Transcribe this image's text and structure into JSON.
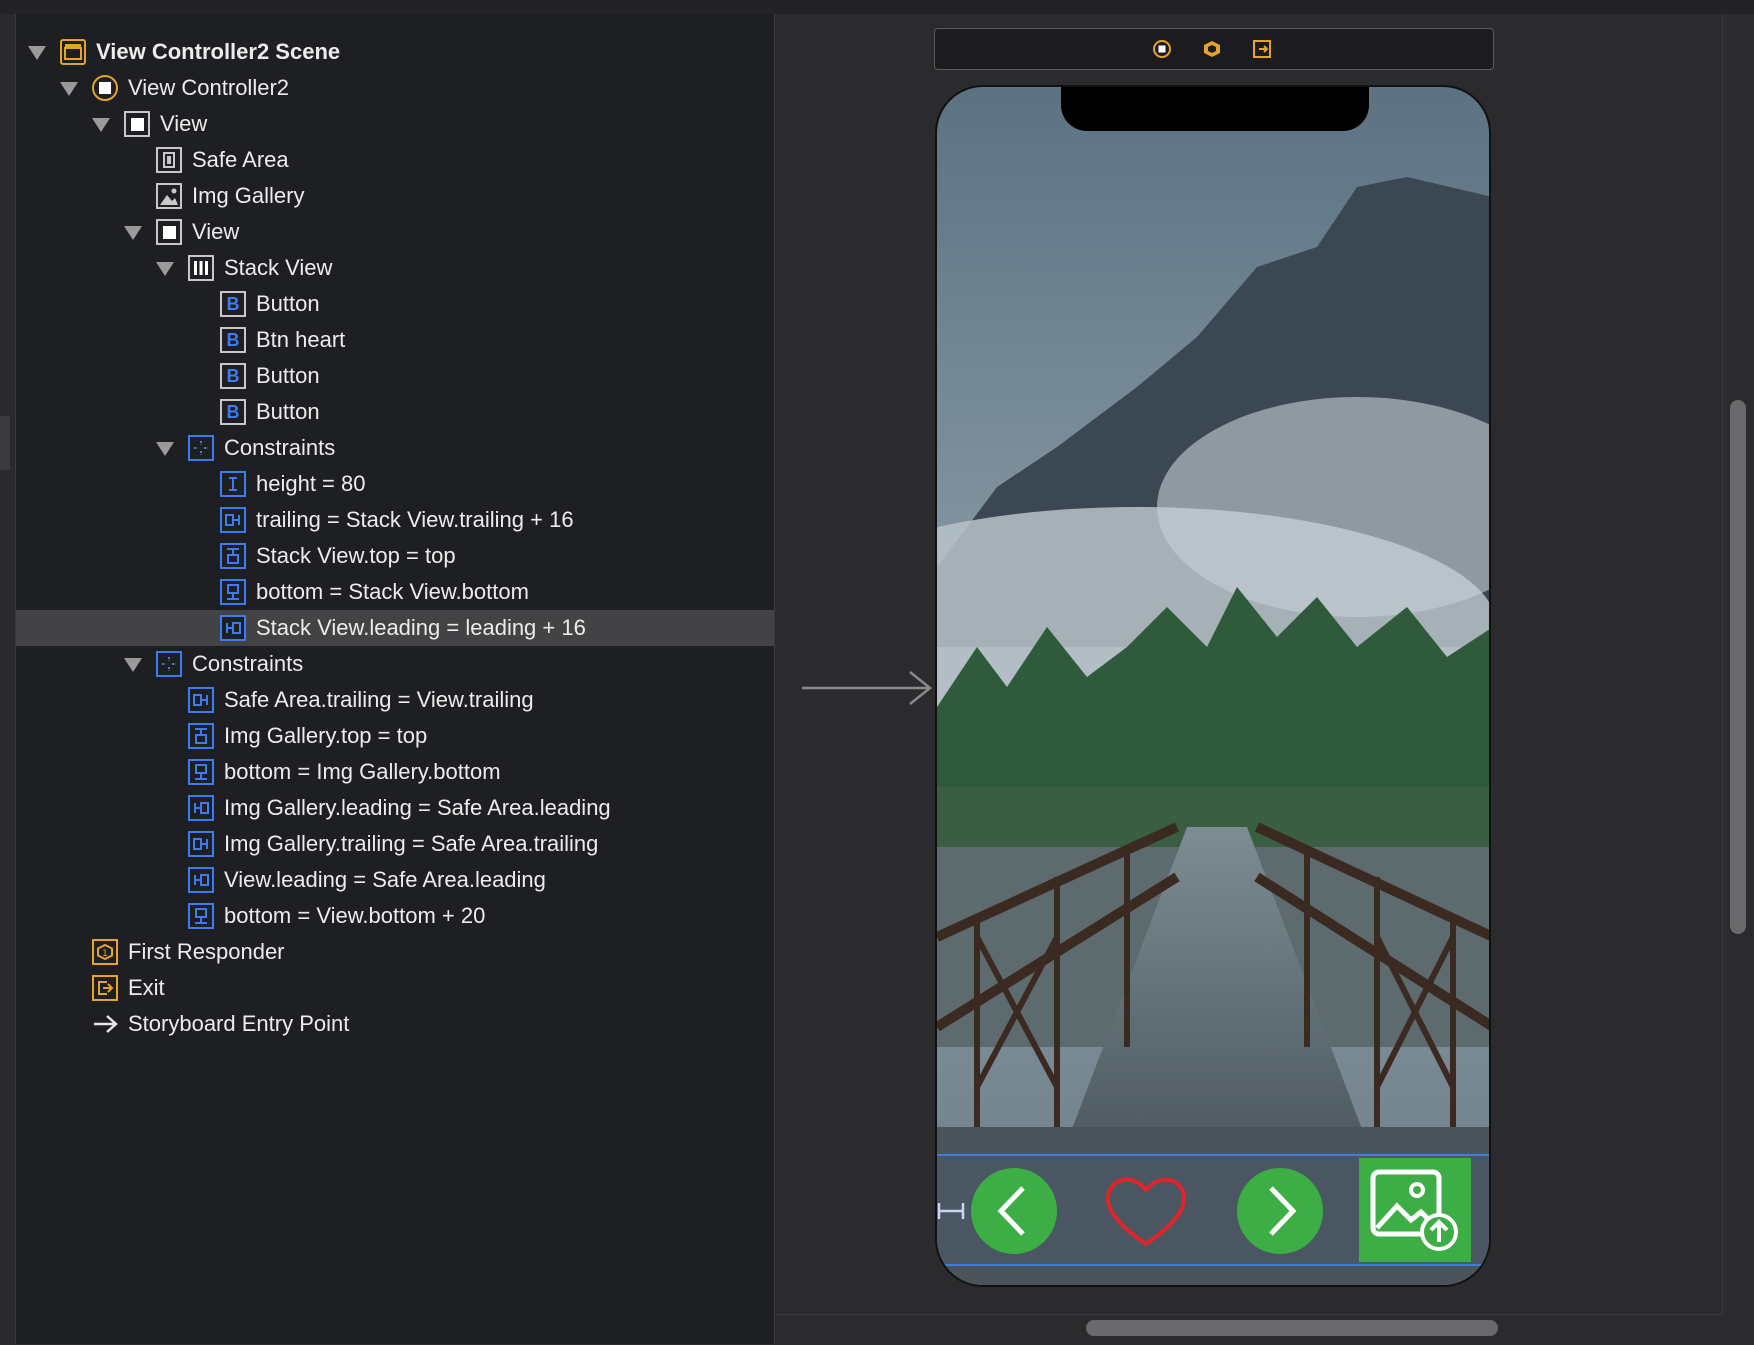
{
  "outline": {
    "rows": [
      {
        "label": "View Controller2 Scene",
        "icon": "scene-icon"
      },
      {
        "label": "View Controller2",
        "icon": "view-controller-icon"
      },
      {
        "label": "View",
        "icon": "view-icon"
      },
      {
        "label": "Safe Area",
        "icon": "safe-area-icon"
      },
      {
        "label": "Img Gallery",
        "icon": "image-view-icon"
      },
      {
        "label": "View",
        "icon": "view-icon"
      },
      {
        "label": "Stack View",
        "icon": "stack-view-icon"
      },
      {
        "label": "Button",
        "icon": "button-icon"
      },
      {
        "label": "Btn heart",
        "icon": "button-icon"
      },
      {
        "label": "Button",
        "icon": "button-icon"
      },
      {
        "label": "Button",
        "icon": "button-icon"
      },
      {
        "label": "Constraints",
        "icon": "constraints-icon"
      },
      {
        "label": "height = 80",
        "icon": "height-constraint-icon"
      },
      {
        "label": "trailing = Stack View.trailing + 16",
        "icon": "trailing-constraint-icon"
      },
      {
        "label": "Stack View.top = top",
        "icon": "top-constraint-icon"
      },
      {
        "label": "bottom = Stack View.bottom",
        "icon": "bottom-constraint-icon"
      },
      {
        "label": "Stack View.leading = leading + 16",
        "icon": "leading-constraint-icon"
      },
      {
        "label": "Constraints",
        "icon": "constraints-icon"
      },
      {
        "label": "Safe Area.trailing = View.trailing",
        "icon": "trailing-constraint-icon"
      },
      {
        "label": "Img Gallery.top = top",
        "icon": "top-constraint-icon"
      },
      {
        "label": "bottom = Img Gallery.bottom",
        "icon": "bottom-constraint-icon"
      },
      {
        "label": "Img Gallery.leading = Safe Area.leading",
        "icon": "leading-constraint-icon"
      },
      {
        "label": "Img Gallery.trailing = Safe Area.trailing",
        "icon": "trailing-constraint-icon"
      },
      {
        "label": "View.leading = Safe Area.leading",
        "icon": "leading-constraint-icon"
      },
      {
        "label": "bottom = View.bottom + 20",
        "icon": "bottom-constraint-icon"
      },
      {
        "label": "First Responder",
        "icon": "first-responder-icon"
      },
      {
        "label": "Exit",
        "icon": "exit-icon"
      },
      {
        "label": "Storyboard Entry Point",
        "icon": "entry-arrow-icon"
      }
    ]
  },
  "canvas": {
    "dock_icons": [
      "view-controller-icon",
      "first-responder-icon",
      "exit-icon"
    ],
    "toolbar_buttons": [
      "back-arrow-icon",
      "heart-icon",
      "forward-arrow-icon",
      "image-upload-icon"
    ]
  },
  "colors": {
    "accent_blue": "#3d7cf0",
    "scene_orange": "#e5a32b",
    "button_green": "#3dae45",
    "heart_red": "#e0242a"
  }
}
